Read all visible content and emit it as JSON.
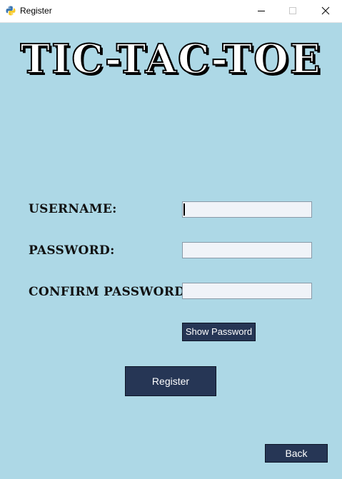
{
  "window": {
    "title": "Register",
    "icon": "python-icon",
    "controls": [
      "minimize-icon",
      "maximize-icon",
      "close-icon"
    ]
  },
  "game_title": "TIC-TAC-TOE",
  "form": {
    "username_label": "USERNAME:",
    "username_value": "",
    "password_label": "PASSWORD:",
    "password_value": "",
    "confirm_label": "CONFIRM PASSWORD:",
    "confirm_value": ""
  },
  "buttons": {
    "show_password": "Show Password",
    "register": "Register",
    "back": "Back"
  },
  "colors": {
    "background": "#add8e6",
    "button": "#263655",
    "field": "#f0f3f8"
  }
}
